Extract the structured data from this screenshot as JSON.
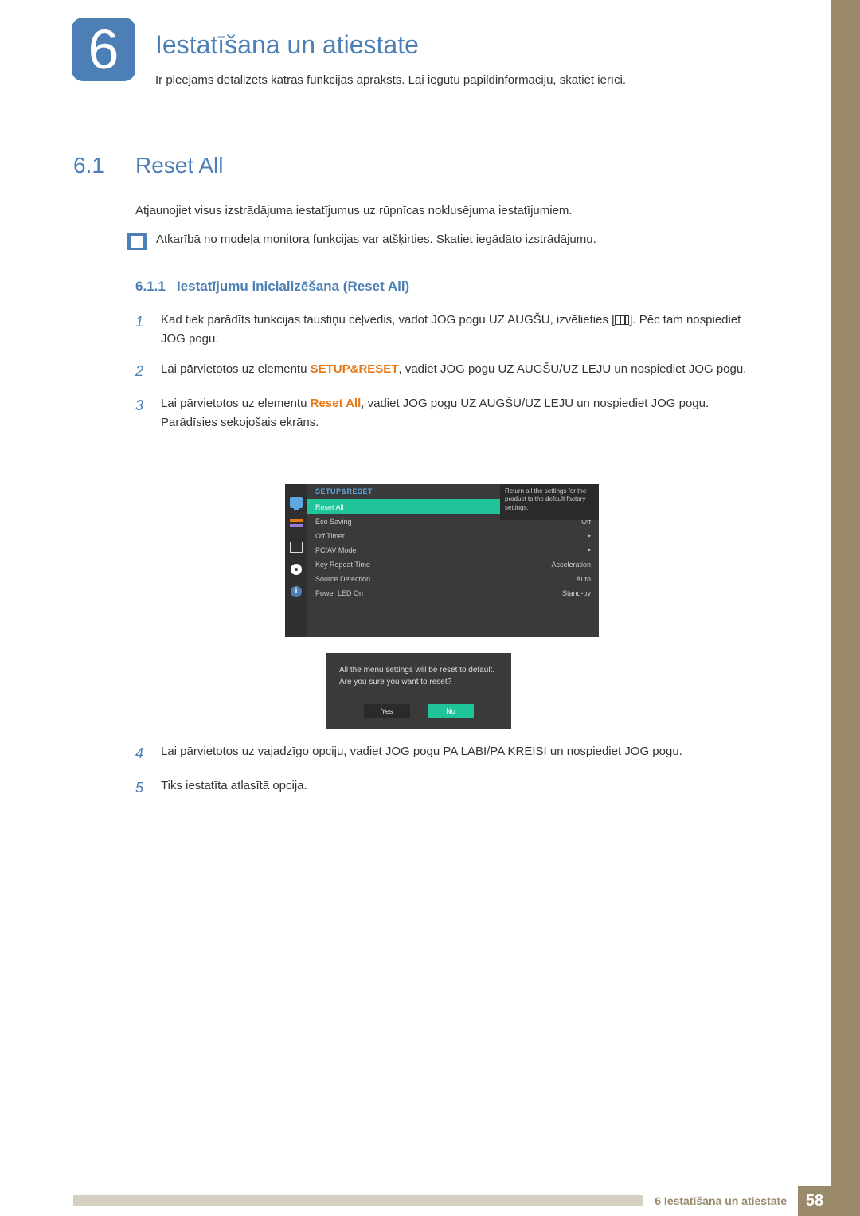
{
  "chapter": {
    "number": "6",
    "title": "Iestatīšana un atiestate",
    "subtitle": "Ir pieejams detalizēts katras funkcijas apraksts. Lai iegūtu papildinformāciju, skatiet ierīci."
  },
  "section": {
    "number": "6.1",
    "title": "Reset All",
    "intro": "Atjaunojiet visus izstrādājuma iestatījumus uz rūpnīcas noklusējuma iestatījumiem.",
    "note": "Atkarībā no modeļa monitora funkcijas var atšķirties. Skatiet iegādāto izstrādājumu."
  },
  "subsection": {
    "number": "6.1.1",
    "title": "Iestatījumu inicializēšana (Reset All)"
  },
  "steps": {
    "s1a": "Kad tiek parādīts funkcijas taustiņu ceļvedis, vadot JOG pogu UZ AUGŠU, izvēlieties [",
    "s1b": "]. Pēc tam nospiediet JOG pogu.",
    "s2a": "Lai pārvietotos uz elementu ",
    "s2b": "SETUP&RESET",
    "s2c": ", vadiet JOG pogu UZ AUGŠU/UZ LEJU un nospiediet JOG pogu.",
    "s3a": "Lai pārvietotos uz elementu ",
    "s3b": "Reset All",
    "s3c": ", vadiet JOG pogu UZ AUGŠU/UZ LEJU un nospiediet JOG pogu.",
    "s3d": "Parādīsies sekojošais ekrāns.",
    "s4": "Lai pārvietotos uz vajadzīgo opciju, vadiet JOG pogu PA LABI/PA KREISI un nospiediet JOG pogu.",
    "s5": "Tiks iestatīta atlasītā opcija."
  },
  "osd": {
    "header": "SETUP&RESET",
    "tip": "Return all the settings for the product to the default factory settings.",
    "rows": [
      {
        "label": "Reset All",
        "value": ""
      },
      {
        "label": "Eco Saving",
        "value": "Off"
      },
      {
        "label": "Off Timer",
        "value": "▸"
      },
      {
        "label": "PC/AV Mode",
        "value": "▸"
      },
      {
        "label": "Key Repeat Time",
        "value": "Acceleration"
      },
      {
        "label": "Source Detection",
        "value": "Auto"
      },
      {
        "label": "Power LED On",
        "value": "Stand-by"
      }
    ]
  },
  "dialog": {
    "line1": "All the menu settings will be reset to default.",
    "line2": "Are you sure you want to reset?",
    "yes": "Yes",
    "no": "No"
  },
  "footer": {
    "label": "6 Iestatīšana un atiestate",
    "page": "58"
  }
}
